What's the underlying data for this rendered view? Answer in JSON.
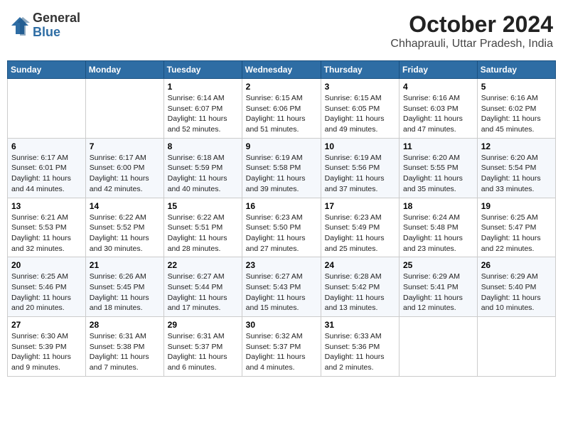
{
  "header": {
    "logo_general": "General",
    "logo_blue": "Blue",
    "month": "October 2024",
    "location": "Chhaprauli, Uttar Pradesh, India"
  },
  "weekdays": [
    "Sunday",
    "Monday",
    "Tuesday",
    "Wednesday",
    "Thursday",
    "Friday",
    "Saturday"
  ],
  "weeks": [
    [
      {
        "day": "",
        "info": ""
      },
      {
        "day": "",
        "info": ""
      },
      {
        "day": "1",
        "info": "Sunrise: 6:14 AM\nSunset: 6:07 PM\nDaylight: 11 hours and 52 minutes."
      },
      {
        "day": "2",
        "info": "Sunrise: 6:15 AM\nSunset: 6:06 PM\nDaylight: 11 hours and 51 minutes."
      },
      {
        "day": "3",
        "info": "Sunrise: 6:15 AM\nSunset: 6:05 PM\nDaylight: 11 hours and 49 minutes."
      },
      {
        "day": "4",
        "info": "Sunrise: 6:16 AM\nSunset: 6:03 PM\nDaylight: 11 hours and 47 minutes."
      },
      {
        "day": "5",
        "info": "Sunrise: 6:16 AM\nSunset: 6:02 PM\nDaylight: 11 hours and 45 minutes."
      }
    ],
    [
      {
        "day": "6",
        "info": "Sunrise: 6:17 AM\nSunset: 6:01 PM\nDaylight: 11 hours and 44 minutes."
      },
      {
        "day": "7",
        "info": "Sunrise: 6:17 AM\nSunset: 6:00 PM\nDaylight: 11 hours and 42 minutes."
      },
      {
        "day": "8",
        "info": "Sunrise: 6:18 AM\nSunset: 5:59 PM\nDaylight: 11 hours and 40 minutes."
      },
      {
        "day": "9",
        "info": "Sunrise: 6:19 AM\nSunset: 5:58 PM\nDaylight: 11 hours and 39 minutes."
      },
      {
        "day": "10",
        "info": "Sunrise: 6:19 AM\nSunset: 5:56 PM\nDaylight: 11 hours and 37 minutes."
      },
      {
        "day": "11",
        "info": "Sunrise: 6:20 AM\nSunset: 5:55 PM\nDaylight: 11 hours and 35 minutes."
      },
      {
        "day": "12",
        "info": "Sunrise: 6:20 AM\nSunset: 5:54 PM\nDaylight: 11 hours and 33 minutes."
      }
    ],
    [
      {
        "day": "13",
        "info": "Sunrise: 6:21 AM\nSunset: 5:53 PM\nDaylight: 11 hours and 32 minutes."
      },
      {
        "day": "14",
        "info": "Sunrise: 6:22 AM\nSunset: 5:52 PM\nDaylight: 11 hours and 30 minutes."
      },
      {
        "day": "15",
        "info": "Sunrise: 6:22 AM\nSunset: 5:51 PM\nDaylight: 11 hours and 28 minutes."
      },
      {
        "day": "16",
        "info": "Sunrise: 6:23 AM\nSunset: 5:50 PM\nDaylight: 11 hours and 27 minutes."
      },
      {
        "day": "17",
        "info": "Sunrise: 6:23 AM\nSunset: 5:49 PM\nDaylight: 11 hours and 25 minutes."
      },
      {
        "day": "18",
        "info": "Sunrise: 6:24 AM\nSunset: 5:48 PM\nDaylight: 11 hours and 23 minutes."
      },
      {
        "day": "19",
        "info": "Sunrise: 6:25 AM\nSunset: 5:47 PM\nDaylight: 11 hours and 22 minutes."
      }
    ],
    [
      {
        "day": "20",
        "info": "Sunrise: 6:25 AM\nSunset: 5:46 PM\nDaylight: 11 hours and 20 minutes."
      },
      {
        "day": "21",
        "info": "Sunrise: 6:26 AM\nSunset: 5:45 PM\nDaylight: 11 hours and 18 minutes."
      },
      {
        "day": "22",
        "info": "Sunrise: 6:27 AM\nSunset: 5:44 PM\nDaylight: 11 hours and 17 minutes."
      },
      {
        "day": "23",
        "info": "Sunrise: 6:27 AM\nSunset: 5:43 PM\nDaylight: 11 hours and 15 minutes."
      },
      {
        "day": "24",
        "info": "Sunrise: 6:28 AM\nSunset: 5:42 PM\nDaylight: 11 hours and 13 minutes."
      },
      {
        "day": "25",
        "info": "Sunrise: 6:29 AM\nSunset: 5:41 PM\nDaylight: 11 hours and 12 minutes."
      },
      {
        "day": "26",
        "info": "Sunrise: 6:29 AM\nSunset: 5:40 PM\nDaylight: 11 hours and 10 minutes."
      }
    ],
    [
      {
        "day": "27",
        "info": "Sunrise: 6:30 AM\nSunset: 5:39 PM\nDaylight: 11 hours and 9 minutes."
      },
      {
        "day": "28",
        "info": "Sunrise: 6:31 AM\nSunset: 5:38 PM\nDaylight: 11 hours and 7 minutes."
      },
      {
        "day": "29",
        "info": "Sunrise: 6:31 AM\nSunset: 5:37 PM\nDaylight: 11 hours and 6 minutes."
      },
      {
        "day": "30",
        "info": "Sunrise: 6:32 AM\nSunset: 5:37 PM\nDaylight: 11 hours and 4 minutes."
      },
      {
        "day": "31",
        "info": "Sunrise: 6:33 AM\nSunset: 5:36 PM\nDaylight: 11 hours and 2 minutes."
      },
      {
        "day": "",
        "info": ""
      },
      {
        "day": "",
        "info": ""
      }
    ]
  ]
}
